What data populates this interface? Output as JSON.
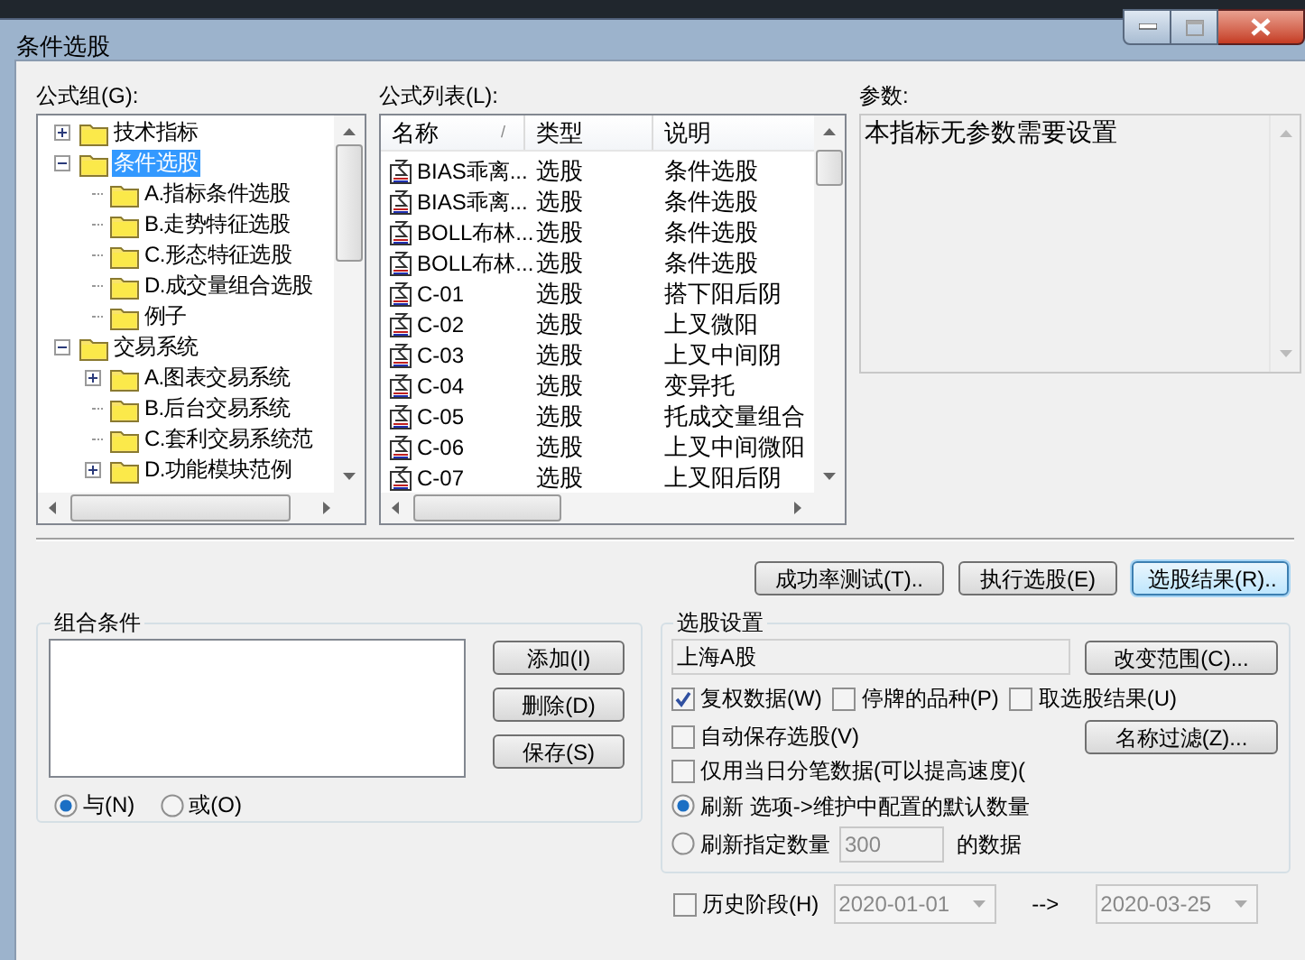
{
  "window": {
    "title": "条件选股"
  },
  "formula_group": {
    "label": "公式组(G):",
    "tree": [
      {
        "label": "技术指标",
        "expanded": false,
        "selected": false
      },
      {
        "label": "条件选股",
        "expanded": true,
        "selected": true,
        "children": [
          {
            "label": "A.指标条件选股",
            "selected": false
          },
          {
            "label": "B.走势特征选股",
            "selected": false
          },
          {
            "label": "C.形态特征选股",
            "selected": false
          },
          {
            "label": "D.成交量组合选股",
            "selected": false
          },
          {
            "label": "例子",
            "selected": false
          }
        ]
      },
      {
        "label": "交易系统",
        "expanded": true,
        "selected": false,
        "children": [
          {
            "label": "A.图表交易系统",
            "expanded": false,
            "selected": false
          },
          {
            "label": "B.后台交易系统",
            "selected": false
          },
          {
            "label": "C.套利交易系统范",
            "selected": false
          },
          {
            "label": "D.功能模块范例",
            "expanded": false,
            "selected": false
          }
        ]
      }
    ]
  },
  "formula_list": {
    "label": "公式列表(L):",
    "columns": [
      {
        "label": "名称",
        "sort_mark": "/"
      },
      {
        "label": "类型"
      },
      {
        "label": "说明"
      }
    ],
    "rows": [
      {
        "name": "BIAS乖离...",
        "type": "选股",
        "description": "条件选股"
      },
      {
        "name": "BIAS乖离...",
        "type": "选股",
        "description": "条件选股"
      },
      {
        "name": "BOLL布林...",
        "type": "选股",
        "description": "条件选股"
      },
      {
        "name": "BOLL布林...",
        "type": "选股",
        "description": "条件选股"
      },
      {
        "name": "C-01",
        "type": "选股",
        "description": "搭下阳后阴"
      },
      {
        "name": "C-02",
        "type": "选股",
        "description": "上叉微阳"
      },
      {
        "name": "C-03",
        "type": "选股",
        "description": "上叉中间阴"
      },
      {
        "name": "C-04",
        "type": "选股",
        "description": "变异托"
      },
      {
        "name": "C-05",
        "type": "选股",
        "description": "托成交量组合"
      },
      {
        "name": "C-06",
        "type": "选股",
        "description": "上叉中间微阳"
      },
      {
        "name": "C-07",
        "type": "选股",
        "description": "上叉阳后阴"
      }
    ]
  },
  "parameters": {
    "label": "参数:",
    "text": "本指标无参数需要设置"
  },
  "action_buttons": [
    {
      "label": "成功率测试(T)..",
      "focused": false
    },
    {
      "label": "执行选股(E)",
      "focused": false
    },
    {
      "label": "选股结果(R)..",
      "focused": true
    }
  ],
  "combination": {
    "title": "组合条件",
    "buttons": [
      "添加(I)",
      "删除(D)",
      "保存(S)"
    ],
    "logic": [
      {
        "label": "与(N)",
        "selected": true
      },
      {
        "label": "或(O)",
        "selected": false
      }
    ]
  },
  "settings": {
    "title": "选股设置",
    "market": "上海A股",
    "change_range_button": "改变范围(C)...",
    "filter_button": "名称过滤(Z)...",
    "options": [
      {
        "label": "复权数据(W)",
        "checked": true
      },
      {
        "label": "停牌的品种(P)",
        "checked": false
      },
      {
        "label": "取选股结果(U)",
        "checked": false
      },
      {
        "label": "自动保存选股(V)",
        "checked": false
      },
      {
        "label": "仅用当日分笔数据(可以提高速度)(",
        "checked": false
      }
    ],
    "refresh": [
      {
        "kind": "default",
        "label": "刷新 选项->维护中配置的默认数量",
        "selected": true
      },
      {
        "kind": "count",
        "label": "刷新指定数量",
        "value": "300",
        "suffix": "的数据",
        "selected": false
      }
    ]
  },
  "history": {
    "label": "历史阶段(H)",
    "checked": false,
    "start": "2020-01-01",
    "arrow": "-->",
    "end": "2020-03-25"
  }
}
